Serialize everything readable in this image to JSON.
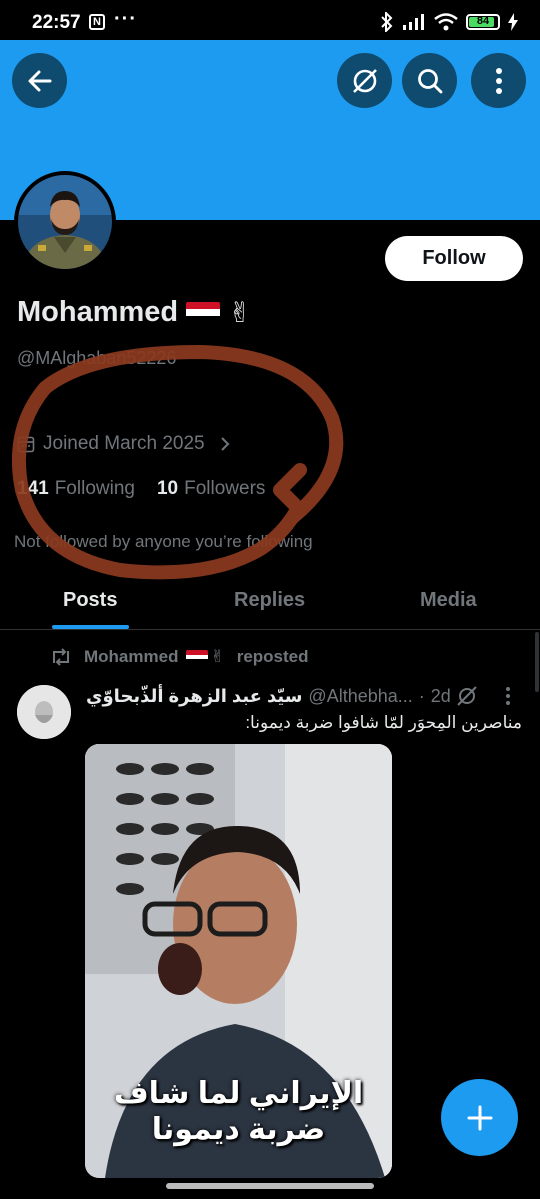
{
  "status_bar": {
    "time": "22:57",
    "notification_icon": "N",
    "more_dots": "···",
    "battery": "84",
    "icons": [
      "bluetooth-icon",
      "signal-icon",
      "wifi-icon",
      "battery-icon",
      "charging-icon"
    ]
  },
  "header": {
    "buttons": [
      "back-arrow-icon",
      "grok-icon",
      "search-icon",
      "more-vertical-icon"
    ],
    "banner_color": "#1d9bf0"
  },
  "profile": {
    "display_name": "Mohammed",
    "name_emojis": [
      "iraq-flag",
      "victory-hand"
    ],
    "handle": "@MAlghaban52226",
    "follow_label": "Follow",
    "joined": "Joined March 2025",
    "following_count": "141",
    "following_label": "Following",
    "followers_count": "10",
    "followers_label": "Followers",
    "not_followed": "Not followed by anyone you’re following"
  },
  "tabs": [
    {
      "label": "Posts",
      "active": true
    },
    {
      "label": "Replies",
      "active": false
    },
    {
      "label": "Media",
      "active": false
    }
  ],
  "post": {
    "repost_user": "Mohammed",
    "repost_label": "reposted",
    "author": "سيّد عبد الزهرة ألذّبحاوّي",
    "handle": "@Althebha...",
    "separator": "·",
    "time": "2d",
    "text": "مناصرين المِحوَر لمّا شافوا ضربة ديمونا:",
    "media_caption_line1": "الإيراني لما شاف",
    "media_caption_line2": "ضربة ديمونا"
  },
  "colors": {
    "accent": "#1d9bf0",
    "annotation": "#8b3a1e",
    "iraq_flag_red": "#ce1126",
    "iraq_flag_green": "#007a3d"
  }
}
